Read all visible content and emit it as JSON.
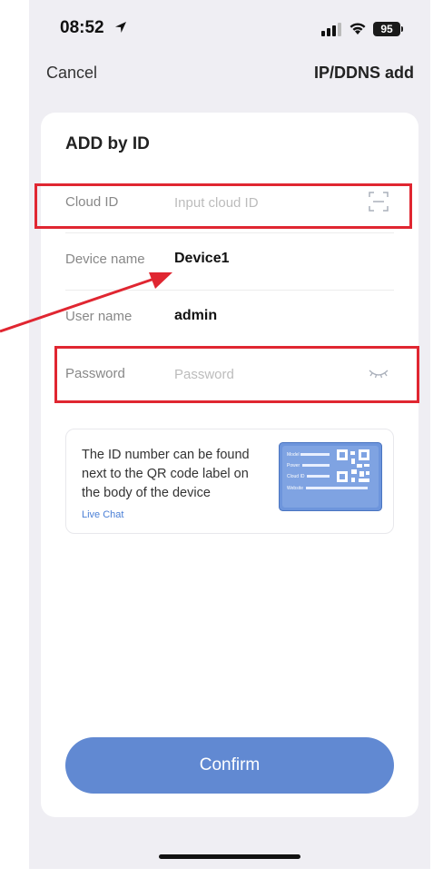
{
  "status_bar": {
    "time": "08:52",
    "battery": "95"
  },
  "nav": {
    "cancel": "Cancel",
    "title": "IP/DDNS add"
  },
  "card": {
    "title": "ADD by ID"
  },
  "fields": {
    "cloud_id": {
      "label": "Cloud ID",
      "placeholder": "Input cloud ID",
      "icon": "scan-icon"
    },
    "device_name": {
      "label": "Device name",
      "value": "Device1"
    },
    "user_name": {
      "label": "User name",
      "value": "admin"
    },
    "password": {
      "label": "Password",
      "placeholder": "Password",
      "icon": "eye-closed-icon"
    }
  },
  "info": {
    "text": "The ID number can be found next to the QR code label on the body of the device",
    "link": "Live Chat",
    "label_lines": [
      "Model",
      "Power",
      "Cloud ID",
      "Website"
    ]
  },
  "confirm": {
    "label": "Confirm"
  },
  "colors": {
    "accent": "#6189d2",
    "highlight": "#e02631",
    "link": "#4a7fd6",
    "background": "#efeef3"
  }
}
